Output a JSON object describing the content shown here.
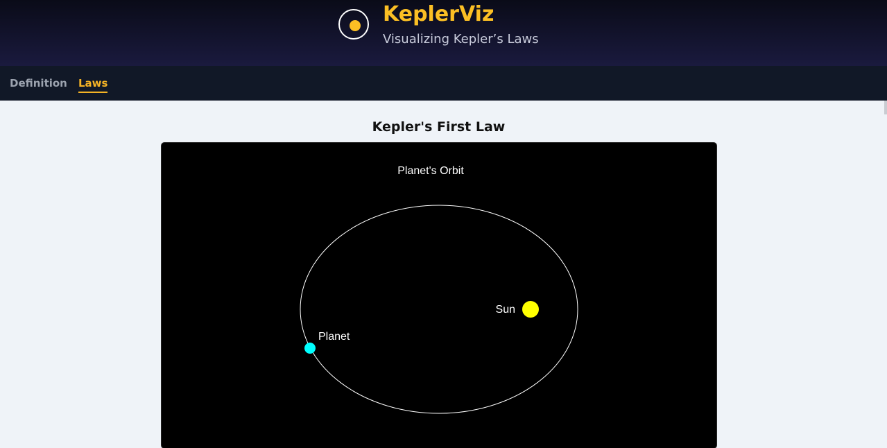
{
  "header": {
    "brand_title": "KeplerViz",
    "brand_subtitle": "Visualizing Kepler’s Laws",
    "logo_icon": "sun-orbit-icon"
  },
  "nav": {
    "items": [
      {
        "label": "Definition",
        "active": false
      },
      {
        "label": "Laws",
        "active": true
      }
    ]
  },
  "main": {
    "section_title": "Kepler's First Law",
    "visualization": {
      "title": "Planet's Orbit",
      "sun_label": "Sun",
      "planet_label": "Planet",
      "colors": {
        "background": "#000000",
        "orbit": "#ffffff",
        "sun": "#ffff00",
        "planet": "#00ffff"
      }
    }
  }
}
